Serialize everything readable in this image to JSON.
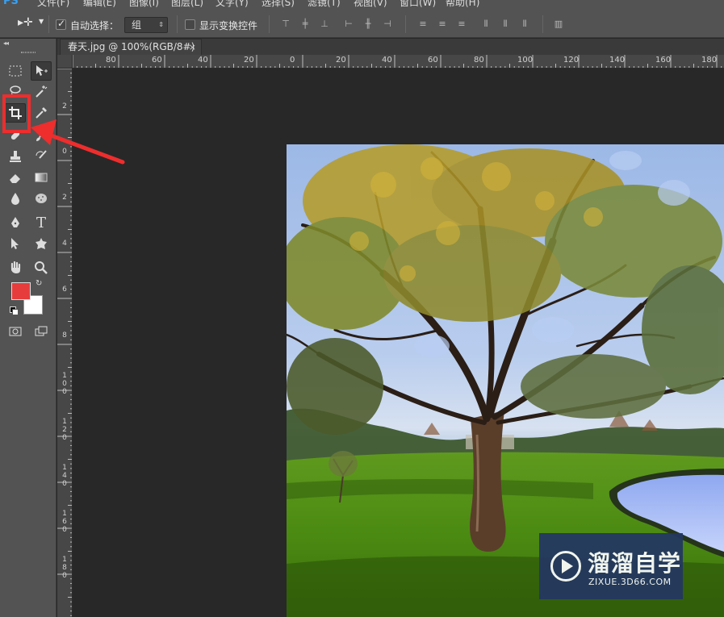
{
  "menubar": {
    "logo": "PS",
    "items": [
      "文件(F)",
      "编辑(E)",
      "图像(I)",
      "图层(L)",
      "文字(Y)",
      "选择(S)",
      "滤镜(T)",
      "视图(V)",
      "窗口(W)",
      "帮助(H)"
    ]
  },
  "options": {
    "auto_select_label": "自动选择：",
    "auto_select_value": "组",
    "show_transform_label": "显示变换控件"
  },
  "document": {
    "tab_title": "春天.jpg @ 100%(RGB/8#)",
    "close": "×"
  },
  "rulers": {
    "horizontal": [
      "80",
      "60",
      "40",
      "20",
      "0",
      "20",
      "40",
      "60",
      "80",
      "100",
      "120",
      "140",
      "160",
      "180"
    ],
    "vertical": [
      "2",
      "0",
      "2",
      "4",
      "6",
      "8",
      "100",
      "120",
      "140",
      "160",
      "180"
    ]
  },
  "toolbar": {
    "type_tool_glyph": "T",
    "swap_glyph": "↻"
  },
  "colors": {
    "foreground": "#e63c3c",
    "background": "#ffffff",
    "highlight": "#ee2d2d"
  },
  "watermark": {
    "title": "溜溜自学",
    "url": "ZIXUE.3D66.COM"
  }
}
